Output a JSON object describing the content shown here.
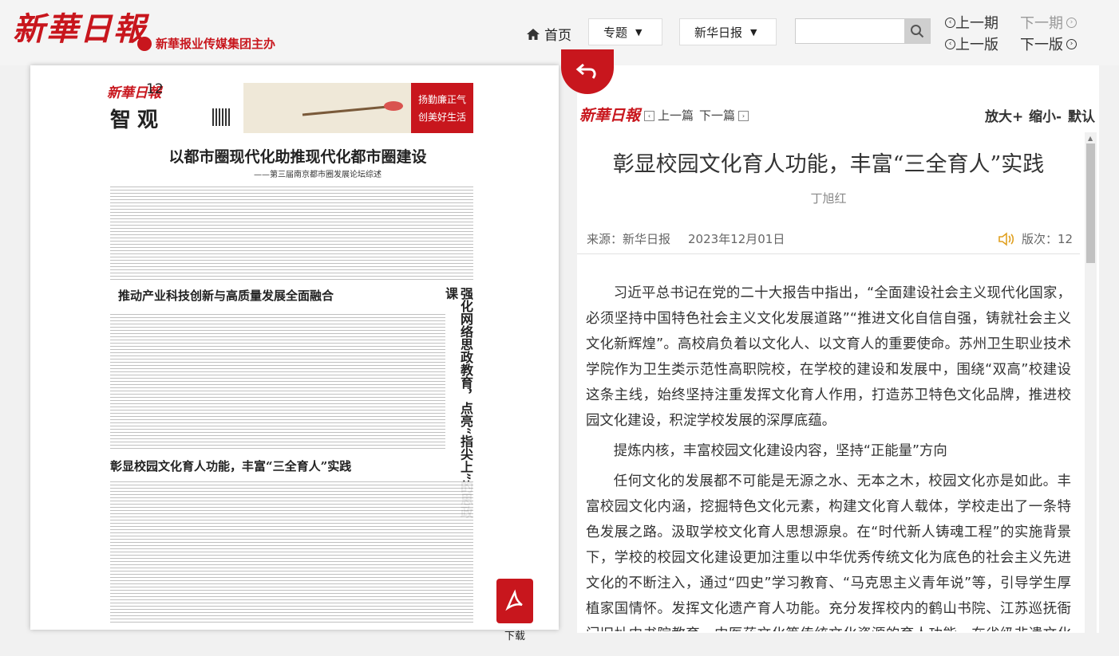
{
  "header": {
    "logo": "新華日報",
    "sublogo": "新華报业传媒集团主办",
    "nav_home": "首页",
    "topic_dropdown": "专题",
    "paper_dropdown": "新华日报",
    "search_placeholder": "",
    "prev_issue": "上一期",
    "next_issue": "下一期",
    "prev_page": "上一版",
    "next_page": "下一版"
  },
  "paper": {
    "logo": "新華日報",
    "page_number": "12",
    "section": "智观",
    "ad_right_line1": "扬勤廉正气",
    "ad_right_line2": "创美好生活",
    "headline1": "以都市圈现代化助推现代化都市圈建设",
    "headline1_sub": "——第三届南京都市圈发展论坛综述",
    "headline2": "推动产业科技创新与高质量发展全面融合",
    "headline3": "彰显校园文化育人功能，丰富“三全育人”实践",
    "vertical_headline": "强化网络思政教育，点亮“指尖上”的思政课",
    "download_label": "下载"
  },
  "article": {
    "logo": "新華日報",
    "prev_article": "上一篇",
    "next_article": "下一篇",
    "zoom_in": "放大+",
    "zoom_out": "缩小-",
    "zoom_default": "默认",
    "title": "彰显校园文化育人功能，丰富“三全育人”实践",
    "author": "丁旭红",
    "source": "来源：新华日报",
    "date": "2023年12月01日",
    "edition": "版次：12",
    "paragraphs": [
      "习近平总书记在党的二十大报告中指出，“全面建设社会主义现代化国家，必须坚持中国特色社会主义文化发展道路”“推进文化自信自强，铸就社会主义文化新辉煌”。高校肩负着以文化人、以文育人的重要使命。苏州卫生职业技术学院作为卫生类示范性高职院校，在学校的建设和发展中，围绕“双高”校建设这条主线，始终坚持注重发挥文化育人作用，打造苏卫特色文化品牌，推进校园文化建设，积淀学校发展的深厚底蕴。",
      "提炼内核，丰富校园文化建设内容，坚持“正能量”方向",
      "任何文化的发展都不可能是无源之水、无本之木，校园文化亦是如此。丰富校园文化内涵，挖掘特色文化元素，构建文化育人载体，学校走出了一条特色发展之路。汲取学校文化育人思想源泉。在“时代新人铸魂工程”的实施背景下，学校的校园文化建设更加注重以中华优秀传统文化为底色的社会主义先进文化的不断注入，通过“四史”学习教育、“马克思主义青年说”等，引导学生厚植家国情怀。发挥文化遗产育人功能。充分发挥校内的鹤山书院、江苏巡抚衙门旧址中书院教育、中医药文化等传统文化资源的育人功能，在省级非遗文化教育基地“苏卫”文化传承"
    ]
  }
}
